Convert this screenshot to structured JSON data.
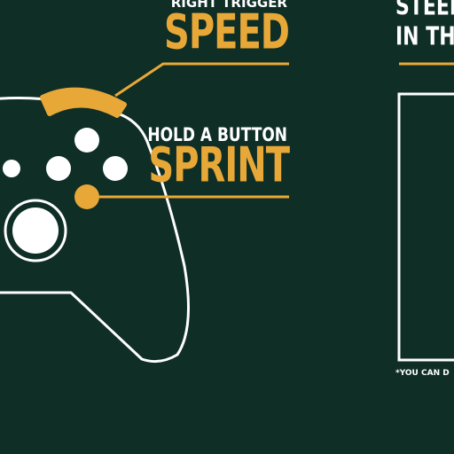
{
  "colors": {
    "background": "#0e2e26",
    "accent": "#e8a838",
    "line": "#ffffff"
  },
  "labels": {
    "right_trigger_small": "RIGHT TRIGGER",
    "speed": "SPEED",
    "hold_button_small": "HOLD A BUTTON",
    "sprint": "SPRINT",
    "steer_small": "STEER",
    "in_the_small": "IN THE",
    "footnote": "*YOU CAN D"
  },
  "icons": {
    "controller": "controller-outline-icon",
    "trigger": "right-trigger-icon",
    "a_button": "a-button-icon"
  }
}
